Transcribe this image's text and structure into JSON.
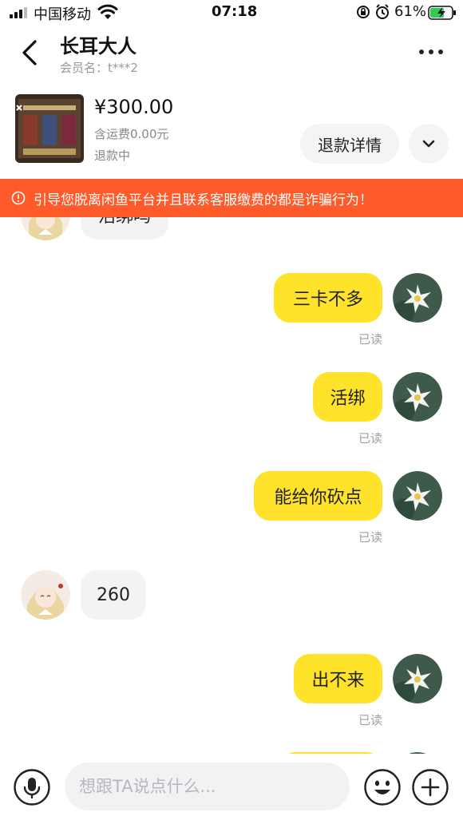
{
  "status_bar": {
    "carrier": "中国移动",
    "time": "07:18",
    "battery_percent": "61%",
    "icons": [
      "signal-icon",
      "wifi-icon",
      "rotation-lock-icon",
      "alarm-icon",
      "battery-charging-icon"
    ]
  },
  "header": {
    "title": "长耳大人",
    "member_label": "会员名：t***2"
  },
  "product": {
    "price": "¥300.00",
    "shipping": "含运费0.00元",
    "status": "退款中",
    "refund_button": "退款详情"
  },
  "warning": {
    "text": "引导您脱离闲鱼平台并且联系客服缴费的都是诈骗行为！",
    "color": "#ff5a2a"
  },
  "messages": [
    {
      "from": "other",
      "text": "活绑吗"
    },
    {
      "from": "me",
      "text": "三卡不多",
      "read": "已读"
    },
    {
      "from": "me",
      "text": "活绑",
      "read": "已读"
    },
    {
      "from": "me",
      "text": "能给你砍点",
      "read": "已读"
    },
    {
      "from": "other",
      "text": "260"
    },
    {
      "from": "me",
      "text": "出不来",
      "read": "已读"
    }
  ],
  "input": {
    "placeholder": "想跟TA说点什么..."
  },
  "colors": {
    "my_bubble": "#ffe22a",
    "their_bubble": "#f3f3f5",
    "read_text": "#a0a0a0"
  }
}
